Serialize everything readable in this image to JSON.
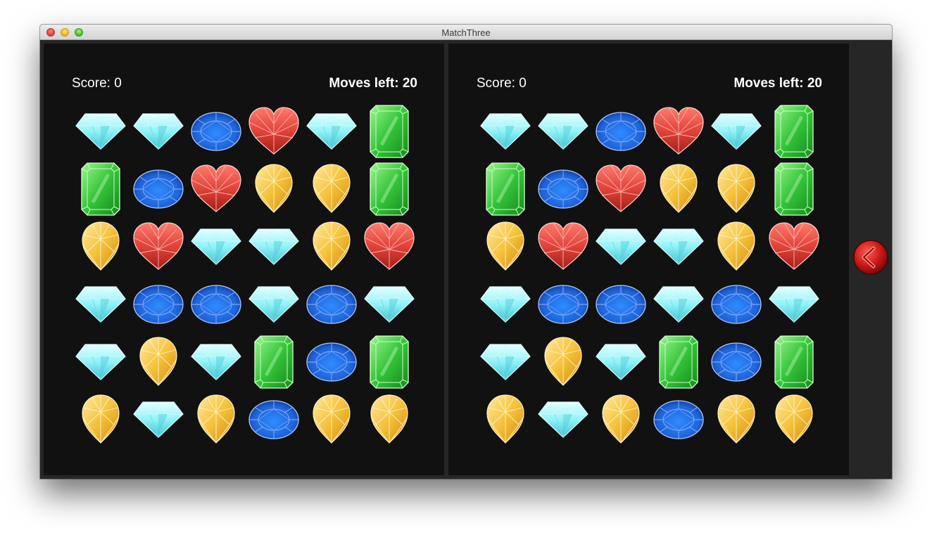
{
  "window": {
    "title": "MatchThree"
  },
  "boards": [
    {
      "score_label": "Score: 0",
      "moves_label": "Moves left: 20",
      "grid": [
        [
          "diamond",
          "diamond",
          "sapphire",
          "ruby",
          "diamond",
          "emerald"
        ],
        [
          "emerald",
          "sapphire",
          "ruby",
          "topaz",
          "topaz",
          "emerald"
        ],
        [
          "topaz",
          "ruby",
          "diamond",
          "diamond",
          "topaz",
          "ruby"
        ],
        [
          "diamond",
          "sapphire",
          "sapphire",
          "diamond",
          "sapphire",
          "diamond"
        ],
        [
          "diamond",
          "topaz",
          "diamond",
          "emerald",
          "sapphire",
          "emerald"
        ],
        [
          "topaz",
          "diamond",
          "topaz",
          "sapphire",
          "topaz",
          "topaz"
        ]
      ]
    },
    {
      "score_label": "Score: 0",
      "moves_label": "Moves left: 20",
      "grid": [
        [
          "diamond",
          "diamond",
          "sapphire",
          "ruby",
          "diamond",
          "emerald"
        ],
        [
          "emerald",
          "sapphire",
          "ruby",
          "topaz",
          "topaz",
          "emerald"
        ],
        [
          "topaz",
          "ruby",
          "diamond",
          "diamond",
          "topaz",
          "ruby"
        ],
        [
          "diamond",
          "sapphire",
          "sapphire",
          "diamond",
          "sapphire",
          "diamond"
        ],
        [
          "diamond",
          "topaz",
          "diamond",
          "emerald",
          "sapphire",
          "emerald"
        ],
        [
          "topaz",
          "diamond",
          "topaz",
          "sapphire",
          "topaz",
          "topaz"
        ]
      ]
    }
  ],
  "side_button": {
    "icon": "back-arrow-icon",
    "color": "#cc1a1a"
  },
  "colors": {
    "board_bg": "#111111",
    "diamond": "#8ff3f7",
    "sapphire": "#1f63d8",
    "ruby": "#e0443a",
    "topaz": "#f5c23a",
    "emerald": "#35c43a"
  }
}
